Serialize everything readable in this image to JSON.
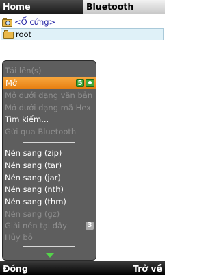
{
  "tabs": {
    "home": "Home",
    "bluetooth": "Bluetooth"
  },
  "files": {
    "drive": "<Ổ cứng>",
    "root": "root"
  },
  "menu": {
    "items": [
      {
        "label": "Tải lên(s)",
        "state": "disabled"
      },
      {
        "label": "Mở",
        "state": "selected",
        "badge": "5"
      },
      {
        "label": "Mở dưới dạng văn bản",
        "state": "disabled"
      },
      {
        "label": "Mở dưới dạng mã Hex",
        "state": "disabled"
      },
      {
        "label": "Tìm kiếm...",
        "state": "enabled"
      },
      {
        "label": "Gửi qua Bluetooth",
        "state": "disabled"
      },
      {
        "label": "Nén sang (zip)",
        "state": "enabled"
      },
      {
        "label": "Nén sang (tar)",
        "state": "enabled"
      },
      {
        "label": "Nén sang (jar)",
        "state": "enabled"
      },
      {
        "label": "Nén sang (nth)",
        "state": "enabled"
      },
      {
        "label": "Nén sang (thm)",
        "state": "enabled"
      },
      {
        "label": "Nén sang (gz)",
        "state": "disabled"
      },
      {
        "label": "Giải nén tại đây",
        "state": "disabled",
        "badge": "3"
      },
      {
        "label": "Hủy bỏ",
        "state": "disabled"
      }
    ]
  },
  "softkeys": {
    "left": "Đóng",
    "right": "Trở về"
  },
  "colors": {
    "selected": "#f39a2e",
    "menu_bg": "#5e5e5e",
    "badge_green": "#3fa83a",
    "arrow": "#54d44a"
  }
}
